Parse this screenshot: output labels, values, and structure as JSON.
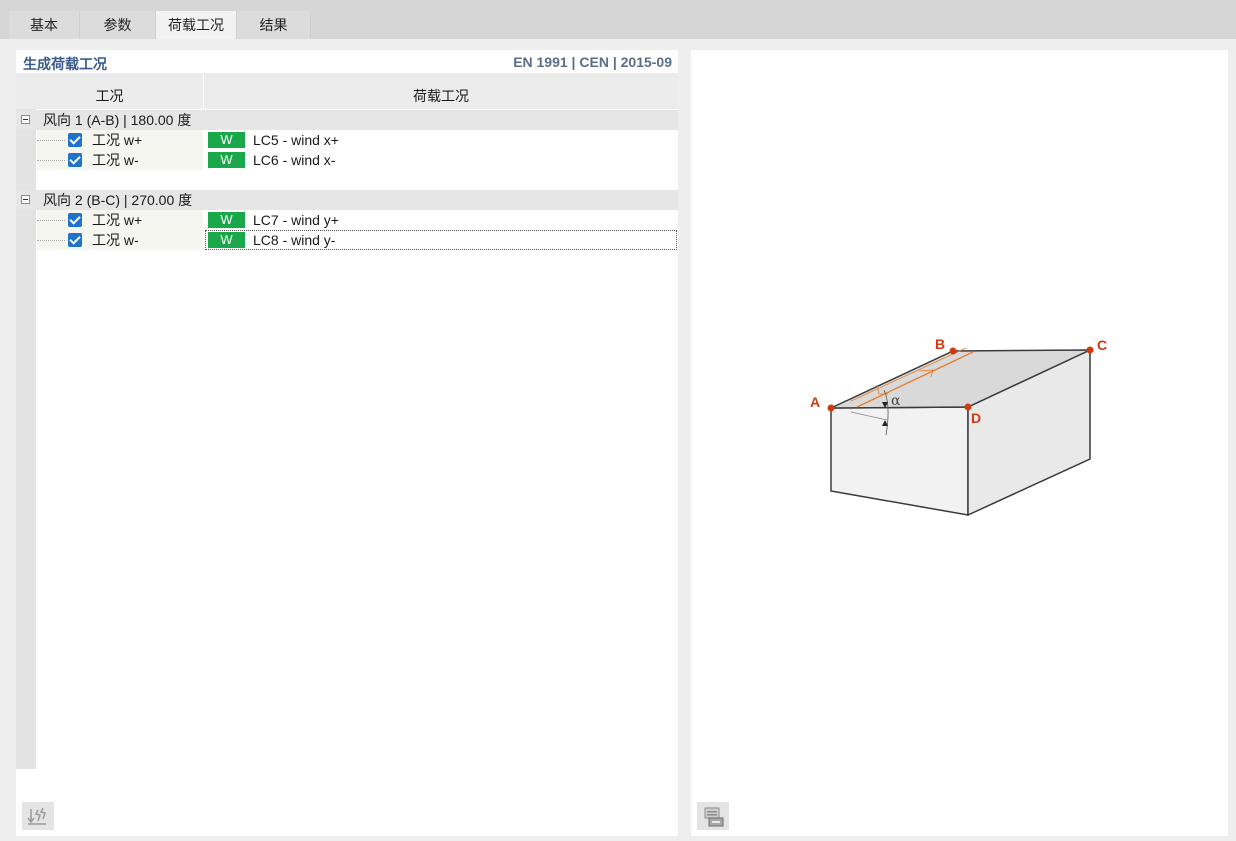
{
  "tabs": [
    {
      "label": "基本",
      "active": false
    },
    {
      "label": "参数",
      "active": false
    },
    {
      "label": "荷载工况",
      "active": true
    },
    {
      "label": "结果",
      "active": false
    }
  ],
  "left_panel": {
    "title": "生成荷载工况",
    "standard": "EN 1991 | CEN | 2015-09",
    "columns": [
      "工况",
      "荷载工况"
    ],
    "groups": [
      {
        "label": "风向 1 (A-B) | 180.00 度",
        "rows": [
          {
            "name": "工况 w+",
            "checked": true,
            "badge": "W",
            "load_case": "LC5 - wind x+"
          },
          {
            "name": "工况 w-",
            "checked": true,
            "badge": "W",
            "load_case": "LC6 - wind x-"
          }
        ]
      },
      {
        "label": "风向 2 (B-C) | 270.00 度",
        "rows": [
          {
            "name": "工况 w+",
            "checked": true,
            "badge": "W",
            "load_case": "LC7 - wind y+"
          },
          {
            "name": "工况 w-",
            "checked": true,
            "badge": "W",
            "load_case": "LC8 - wind y-"
          }
        ]
      }
    ]
  },
  "diagram": {
    "points": [
      "A",
      "B",
      "C",
      "D"
    ],
    "angle_label": "α",
    "point_color": "#d03a10",
    "ridge_color": "#e87a2a"
  },
  "colors": {
    "accent": "#1f73c9",
    "badge": "#1aa84a",
    "title": "#3a5a8a"
  },
  "icons": {
    "left_bottom": "generate-icon",
    "right_bottom": "print-icon"
  }
}
